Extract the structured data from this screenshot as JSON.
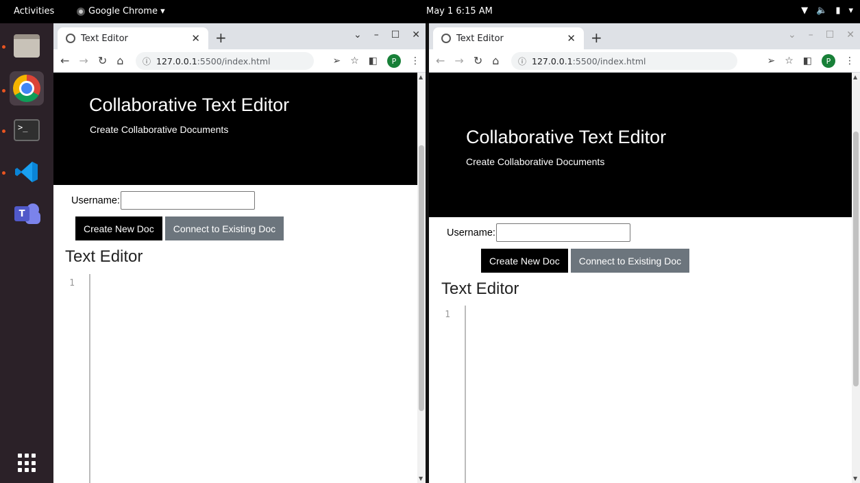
{
  "topbar": {
    "activities": "Activities",
    "app_menu": "Google Chrome ▾",
    "clock": "May 1  6:15 AM"
  },
  "dock": {
    "items": [
      "files",
      "chrome",
      "terminal",
      "vscode",
      "teams",
      "show-apps"
    ]
  },
  "colors": {
    "hero_bg": "#000000",
    "secondary_button": "#6c757d",
    "dock_bg": "#2b2128"
  },
  "windows": [
    {
      "tab_title": "Text Editor",
      "url_host": "127.0.0.1",
      "url_rest": ":5500/index.html",
      "avatar": "P",
      "page": {
        "title": "Collaborative Text Editor",
        "subtitle": "Create Collaborative Documents",
        "username_label": "Username:",
        "username_value": "",
        "create_button": "Create New Doc",
        "connect_button": "Connect to Existing Doc",
        "editor_heading": "Text Editor",
        "line_number": "1"
      }
    },
    {
      "tab_title": "Text Editor",
      "url_host": "127.0.0.1",
      "url_rest": ":5500/index.html",
      "avatar": "P",
      "page": {
        "title": "Collaborative Text Editor",
        "subtitle": "Create Collaborative Documents",
        "username_label": "Username:",
        "username_value": "",
        "create_button": "Create New Doc",
        "connect_button": "Connect to Existing Doc",
        "editor_heading": "Text Editor",
        "line_number": "1"
      }
    }
  ]
}
